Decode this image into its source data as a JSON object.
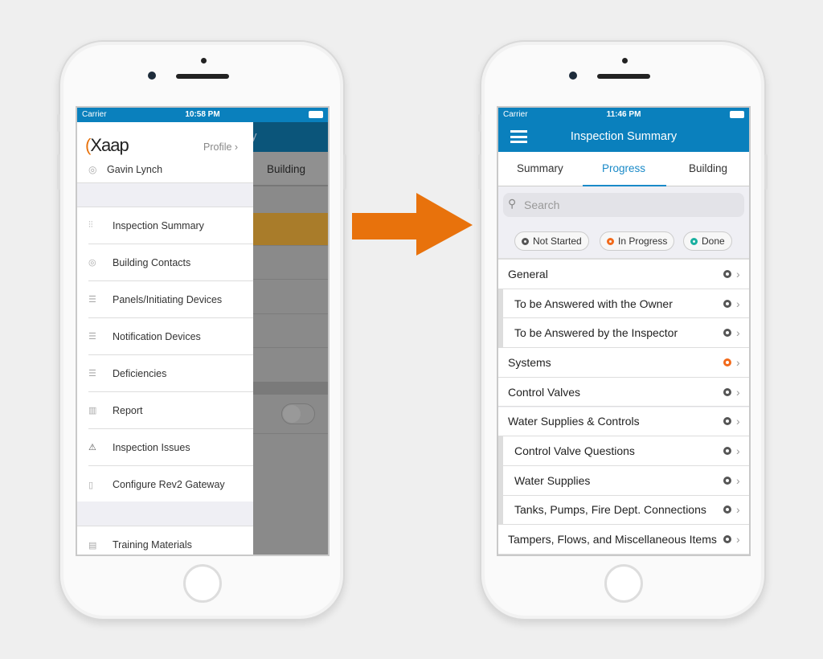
{
  "left_phone": {
    "status": {
      "carrier": "Carrier",
      "time": "10:58 PM"
    },
    "background": {
      "title_fragment": "y",
      "tab": "Building"
    },
    "drawer": {
      "logo": "Xaap",
      "profile_label": "Profile",
      "user_name": "Gavin Lynch",
      "items": [
        {
          "label": "Inspection Summary",
          "icon": "sliders-icon"
        },
        {
          "label": "Building Contacts",
          "icon": "contacts-icon"
        },
        {
          "label": "Panels/Initiating Devices",
          "icon": "checklist-icon"
        },
        {
          "label": "Notification Devices",
          "icon": "checklist-icon"
        },
        {
          "label": "Deficiencies",
          "icon": "checklist-icon"
        },
        {
          "label": "Report",
          "icon": "bar-chart-icon"
        },
        {
          "label": "Inspection Issues",
          "icon": "warning-icon"
        },
        {
          "label": "Configure Rev2 Gateway",
          "icon": "device-icon"
        }
      ],
      "footer_items": [
        {
          "label": "Training Materials",
          "icon": "book-icon"
        }
      ]
    }
  },
  "arrow_color": "#e8720c",
  "right_phone": {
    "status": {
      "carrier": "Carrier",
      "time": "11:46 PM"
    },
    "header": {
      "title": "Inspection Summary"
    },
    "tabs": [
      {
        "label": "Summary"
      },
      {
        "label": "Progress",
        "active": true
      },
      {
        "label": "Building"
      }
    ],
    "search": {
      "placeholder": "Search"
    },
    "filters": [
      {
        "label": "Not Started",
        "color": "#555555"
      },
      {
        "label": "In Progress",
        "color": "#f26a1b"
      },
      {
        "label": "Done",
        "color": "#1ab0a0"
      }
    ],
    "rows": [
      {
        "label": "General",
        "sub": false,
        "status": "not-started"
      },
      {
        "label": "To be Answered with the Owner",
        "sub": true,
        "status": "not-started"
      },
      {
        "label": "To be Answered by the Inspector",
        "sub": true,
        "status": "not-started"
      },
      {
        "label": "Systems",
        "sub": false,
        "status": "in-progress"
      },
      {
        "label": "Control Valves",
        "sub": false,
        "status": "not-started"
      },
      {
        "label": "Water Supplies & Controls",
        "sub": false,
        "status": "not-started"
      },
      {
        "label": "Control Valve Questions",
        "sub": true,
        "status": "not-started"
      },
      {
        "label": "Water Supplies",
        "sub": true,
        "status": "not-started"
      },
      {
        "label": "Tanks, Pumps, Fire Dept. Connections",
        "sub": true,
        "status": "not-started"
      },
      {
        "label": "Tampers, Flows, and Miscellaneous Items",
        "sub": false,
        "status": "not-started"
      }
    ],
    "colors": {
      "brand": "#0a80bd",
      "accent": "#1a8ac8"
    }
  }
}
